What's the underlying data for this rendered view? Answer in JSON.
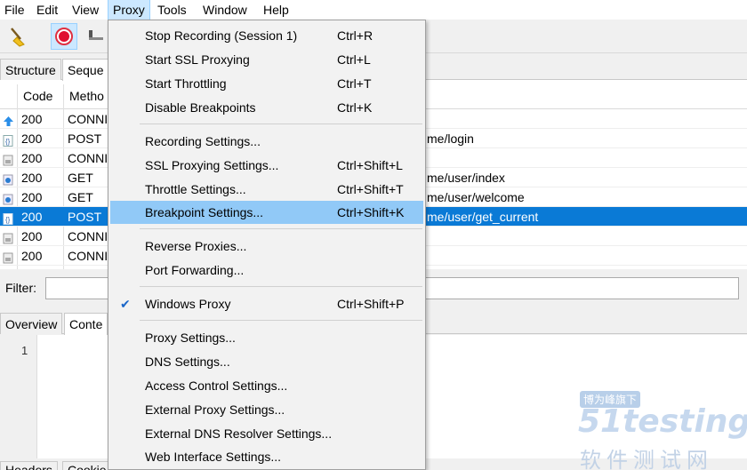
{
  "menubar": {
    "items": [
      "File",
      "Edit",
      "View",
      "Proxy",
      "Tools",
      "Window",
      "Help"
    ],
    "active": "Proxy"
  },
  "toolbar": {
    "buttons": [
      "broom-icon",
      "record-icon",
      "throttle-icon"
    ]
  },
  "top_tabs": [
    "Structure",
    "Seque"
  ],
  "table": {
    "columns": [
      "Code",
      "Metho"
    ],
    "rows": [
      {
        "icon": "arrow-up-icon",
        "code": "200",
        "method": "CONNI",
        "path": ""
      },
      {
        "icon": "json-icon",
        "code": "200",
        "method": "POST",
        "path": "me/login"
      },
      {
        "icon": "lock-icon",
        "code": "200",
        "method": "CONNI",
        "path": ""
      },
      {
        "icon": "globe-icon",
        "code": "200",
        "method": "GET",
        "path": "me/user/index"
      },
      {
        "icon": "globe-icon",
        "code": "200",
        "method": "GET",
        "path": "me/user/welcome"
      },
      {
        "icon": "json-icon",
        "code": "200",
        "method": "POST",
        "path": "me/user/get_current"
      },
      {
        "icon": "lock-icon",
        "code": "200",
        "method": "CONNI",
        "path": ""
      },
      {
        "icon": "lock-icon",
        "code": "200",
        "method": "CONNI",
        "path": ""
      }
    ]
  },
  "filter": {
    "label": "Filter:",
    "value": ""
  },
  "lower_tabs": [
    "Overview",
    "Conte"
  ],
  "content": {
    "line_number": "1"
  },
  "bottom_tabs": [
    "Headers",
    "Cookie"
  ],
  "proxy_menu": {
    "items": [
      {
        "label": "Stop Recording (Session 1)",
        "shortcut": "Ctrl+R"
      },
      {
        "label": "Start SSL Proxying",
        "shortcut": "Ctrl+L"
      },
      {
        "label": "Start Throttling",
        "shortcut": "Ctrl+T"
      },
      {
        "label": "Disable Breakpoints",
        "shortcut": "Ctrl+K"
      },
      {
        "label": "Recording Settings...",
        "shortcut": ""
      },
      {
        "label": "SSL Proxying Settings...",
        "shortcut": "Ctrl+Shift+L"
      },
      {
        "label": "Throttle Settings...",
        "shortcut": "Ctrl+Shift+T"
      },
      {
        "label": "Breakpoint Settings...",
        "shortcut": "Ctrl+Shift+K"
      },
      {
        "label": "Reverse Proxies...",
        "shortcut": ""
      },
      {
        "label": "Port Forwarding...",
        "shortcut": ""
      },
      {
        "label": "Windows Proxy",
        "shortcut": "Ctrl+Shift+P",
        "checked": true
      },
      {
        "label": "Proxy Settings...",
        "shortcut": ""
      },
      {
        "label": "DNS Settings...",
        "shortcut": ""
      },
      {
        "label": "Access Control Settings...",
        "shortcut": ""
      },
      {
        "label": "External Proxy Settings...",
        "shortcut": ""
      },
      {
        "label": "External DNS Resolver Settings...",
        "shortcut": ""
      },
      {
        "label": "Web Interface Settings...",
        "shortcut": ""
      }
    ],
    "highlighted": "Breakpoint Settings...",
    "check_mark": "✔"
  },
  "watermark": {
    "top": "博为峰旗下",
    "logo": "51testing",
    "bottom": "软件测试网"
  },
  "colors": {
    "selection": "#0a7ad6",
    "menu_highlight": "#91c9f7",
    "menubar_active": "#cce8ff"
  }
}
